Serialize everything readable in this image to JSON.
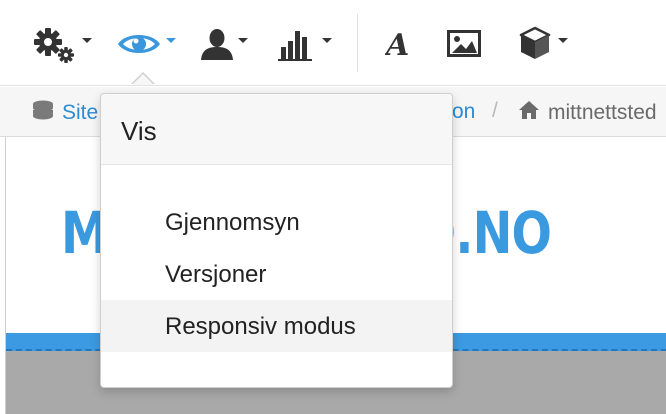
{
  "toolbar": {
    "buttons": [
      {
        "name": "settings",
        "icon": "gears-icon"
      },
      {
        "name": "view",
        "icon": "eye-icon",
        "active": true,
        "color": "#3a96dd"
      },
      {
        "name": "user",
        "icon": "user-icon"
      },
      {
        "name": "statistics",
        "icon": "bar-chart-icon"
      },
      {
        "name": "text",
        "icon": "font-icon"
      },
      {
        "name": "image",
        "icon": "image-icon"
      },
      {
        "name": "modules",
        "icon": "cube-icon"
      }
    ]
  },
  "breadcrumb": {
    "root_label": "Site",
    "middle_label": "on",
    "separator": "/",
    "current_label": "mittnettsted",
    "link_color": "#2d8bd0"
  },
  "preview": {
    "site_title_left": "M",
    "site_title_right": "ED.NO",
    "brand_color": "#3a9ae0"
  },
  "view_menu": {
    "header": "Vis",
    "items": [
      {
        "label": "Gjennomsyn"
      },
      {
        "label": "Versjoner"
      },
      {
        "label": "Responsiv modus",
        "highlighted": true
      }
    ]
  }
}
